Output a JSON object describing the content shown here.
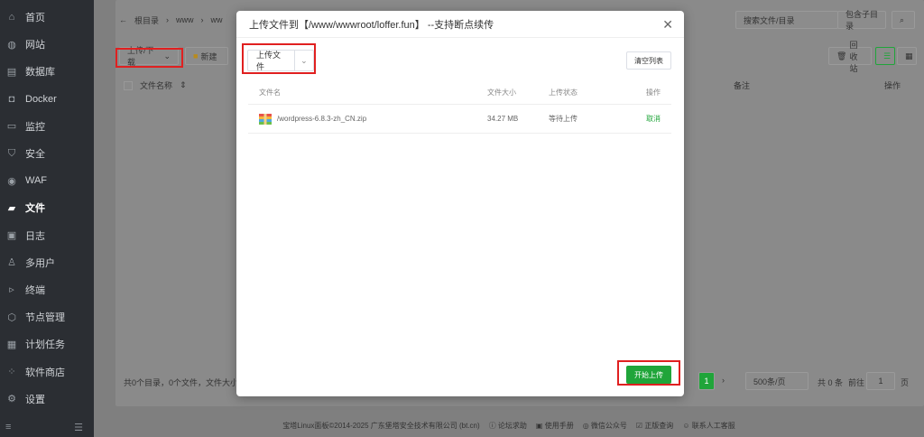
{
  "sidebar": {
    "items": [
      {
        "label": "首页",
        "icon": "home-icon"
      },
      {
        "label": "网站",
        "icon": "globe-icon"
      },
      {
        "label": "数据库",
        "icon": "database-icon"
      },
      {
        "label": "Docker",
        "icon": "docker-icon"
      },
      {
        "label": "监控",
        "icon": "monitor-icon"
      },
      {
        "label": "安全",
        "icon": "shield-icon"
      },
      {
        "label": "WAF",
        "icon": "waf-icon"
      },
      {
        "label": "文件",
        "icon": "folder-icon"
      },
      {
        "label": "日志",
        "icon": "log-icon"
      },
      {
        "label": "多用户",
        "icon": "user-icon"
      },
      {
        "label": "终端",
        "icon": "terminal-icon"
      },
      {
        "label": "节点管理",
        "icon": "node-icon"
      },
      {
        "label": "计划任务",
        "icon": "calendar-icon"
      },
      {
        "label": "软件商店",
        "icon": "apps-icon"
      },
      {
        "label": "设置",
        "icon": "gear-icon"
      }
    ],
    "active_label": "文件"
  },
  "background": {
    "path_root": "根目录",
    "path_seg1": "www",
    "path_seg2": "ww",
    "upload_download": "上传/下载",
    "new": "新建",
    "recycle": "回收站",
    "search_placeholder": "搜索文件/目录",
    "include_subdir": "包含子目录",
    "col_name": "文件名称",
    "col_remark": "备注",
    "col_action": "操作",
    "summary": "共0个目录，0个文件，文件大小",
    "page_num": "1",
    "page_size": "500条/页",
    "total": "共 0 条",
    "goto": "前往",
    "goto_value": "1",
    "page_unit": "页"
  },
  "footer": {
    "copyright": "宝塔Linux面板©2014-2025 广东堡塔安全技术有限公司 (bt.cn)",
    "forum": "论坛求助",
    "manual": "使用手册",
    "wechat": "微信公众号",
    "verify": "正版查询",
    "support": "联系人工客服"
  },
  "modal": {
    "title": "上传文件到【/www/wwwroot/loffer.fun】 --支持断点续传",
    "upload_file": "上传文件",
    "clear_list": "清空列表",
    "headers": {
      "name": "文件名",
      "size": "文件大小",
      "status": "上传状态",
      "action": "操作"
    },
    "files": [
      {
        "name": "/wordpress-6.8.3-zh_CN.zip",
        "size": "34.27 MB",
        "status": "等待上传",
        "action": "取消"
      }
    ],
    "start_upload": "开始上传"
  }
}
